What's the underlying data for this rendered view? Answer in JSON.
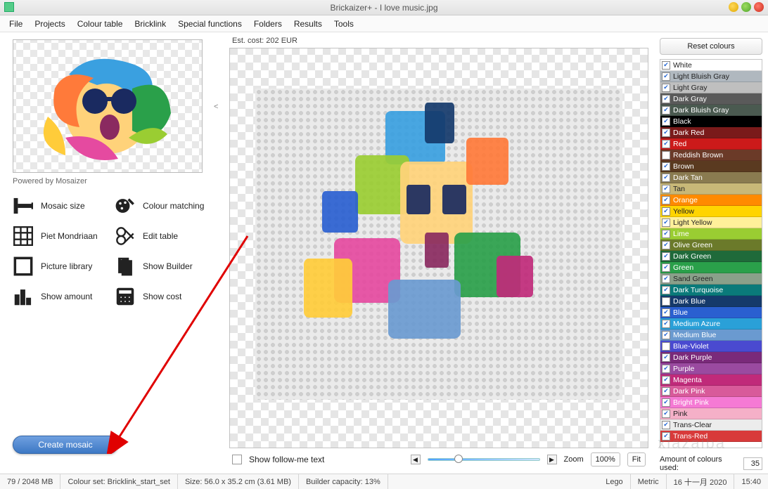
{
  "title": "Brickaizer+  - I love music.jpg",
  "menu": [
    "File",
    "Projects",
    "Colour table",
    "Bricklink",
    "Special functions",
    "Folders",
    "Results",
    "Tools"
  ],
  "left": {
    "powered": "Powered by Mosaizer",
    "actions": [
      {
        "k": "mosaic-size",
        "label": "Mosaic size"
      },
      {
        "k": "colour-matching",
        "label": "Colour matching"
      },
      {
        "k": "piet",
        "label": "Piet Mondriaan"
      },
      {
        "k": "edit-table",
        "label": "Edit table"
      },
      {
        "k": "picture-lib",
        "label": "Picture library"
      },
      {
        "k": "show-builder",
        "label": "Show Builder"
      },
      {
        "k": "show-amount",
        "label": "Show amount"
      },
      {
        "k": "show-cost",
        "label": "Show cost"
      }
    ],
    "create_label": "Create mosaic"
  },
  "center": {
    "est_cost": "Est. cost: 202 EUR",
    "follow_me": "Show follow-me text",
    "zoom_label": "Zoom",
    "zoom_pct": "100%",
    "fit_label": "Fit"
  },
  "right": {
    "reset": "Reset colours",
    "amount_label": "Amount of colours used:",
    "amount_value": "35",
    "colours": [
      {
        "n": "White",
        "c": "#ffffff",
        "t": "#222",
        "on": true
      },
      {
        "n": "Light Bluish Gray",
        "c": "#b0b8bf",
        "t": "#222",
        "on": true
      },
      {
        "n": "Light Gray",
        "c": "#bfbfbf",
        "t": "#222",
        "on": true
      },
      {
        "n": "Dark Gray",
        "c": "#5a5a5a",
        "on": true
      },
      {
        "n": "Dark Bluish Gray",
        "c": "#4a5a50",
        "on": true
      },
      {
        "n": "Black",
        "c": "#000000",
        "on": true
      },
      {
        "n": "Dark Red",
        "c": "#7a1a1a",
        "on": true
      },
      {
        "n": "Red",
        "c": "#cc1a1a",
        "on": true
      },
      {
        "n": "Reddish Brown",
        "c": "#6b3a28",
        "on": false
      },
      {
        "n": "Brown",
        "c": "#5a3a20",
        "on": true
      },
      {
        "n": "Dark Tan",
        "c": "#8a7b50",
        "on": true
      },
      {
        "n": "Tan",
        "c": "#c8b878",
        "t": "#222",
        "on": true
      },
      {
        "n": "Orange",
        "c": "#ff8a00",
        "on": true
      },
      {
        "n": "Yellow",
        "c": "#ffd400",
        "t": "#222",
        "on": true
      },
      {
        "n": "Light Yellow",
        "c": "#fff09a",
        "t": "#222",
        "on": true
      },
      {
        "n": "Lime",
        "c": "#9acd32",
        "on": true
      },
      {
        "n": "Olive Green",
        "c": "#6b7a2a",
        "on": true
      },
      {
        "n": "Dark Green",
        "c": "#1f6a3a",
        "on": true
      },
      {
        "n": "Green",
        "c": "#2aa04a",
        "on": true
      },
      {
        "n": "Sand Green",
        "c": "#8aa08a",
        "t": "#222",
        "on": true
      },
      {
        "n": "Dark Turquoise",
        "c": "#0a7a7a",
        "on": true
      },
      {
        "n": "Dark Blue",
        "c": "#153a6b",
        "on": false
      },
      {
        "n": "Blue",
        "c": "#2a5fd0",
        "on": true
      },
      {
        "n": "Medium Azure",
        "c": "#2aa0d8",
        "on": true
      },
      {
        "n": "Medium Blue",
        "c": "#6a9ad0",
        "on": true
      },
      {
        "n": "Blue-Violet",
        "c": "#4a4ad0",
        "on": false
      },
      {
        "n": "Dark Purple",
        "c": "#7a2a7a",
        "on": true
      },
      {
        "n": "Purple",
        "c": "#9a4aa0",
        "on": true
      },
      {
        "n": "Magenta",
        "c": "#c02a7a",
        "on": true
      },
      {
        "n": "Dark Pink",
        "c": "#d85a9a",
        "on": true
      },
      {
        "n": "Bright Pink",
        "c": "#f57ad4",
        "on": true
      },
      {
        "n": "Pink",
        "c": "#f5b0c8",
        "t": "#222",
        "on": true
      },
      {
        "n": "Trans-Clear",
        "c": "#ececec",
        "t": "#222",
        "on": true
      },
      {
        "n": "Trans-Red",
        "c": "#d83a3a",
        "on": true
      }
    ]
  },
  "status": {
    "mem": "79 / 2048 MB",
    "colourset": "Colour set: Bricklink_start_set",
    "size": "Size: 56.0 x 35.2 cm (3.61 MB)",
    "builder": "Builder capacity: 13%",
    "lego": "Lego",
    "metric": "Metric",
    "date": "16 十一月 2020",
    "time": "15:40"
  },
  "collapse": "<"
}
